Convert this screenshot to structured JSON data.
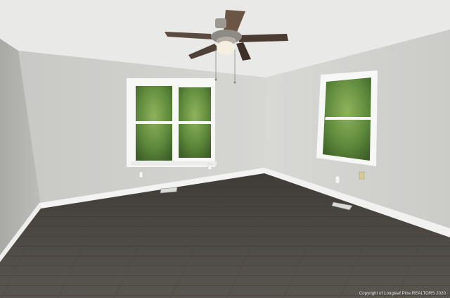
{
  "scene": {
    "subject": "Empty room with ceiling fan and two windows",
    "colors": {
      "ceiling": "#e9e9e7",
      "wall_back": "#cfcfcc",
      "wall_right": "#d2d2cf",
      "wall_left": "#b9b9b6",
      "floor": "#4f4b46",
      "baseboard": "#f3f3f1",
      "window_frame": "#f7f7f5",
      "foliage": "#5f8a3c",
      "fan_blade": "#5a4a3f",
      "fan_light": "#f4efe0"
    }
  },
  "watermark": {
    "text": "Copyright of Longleaf Pine REALTORS 2020"
  }
}
